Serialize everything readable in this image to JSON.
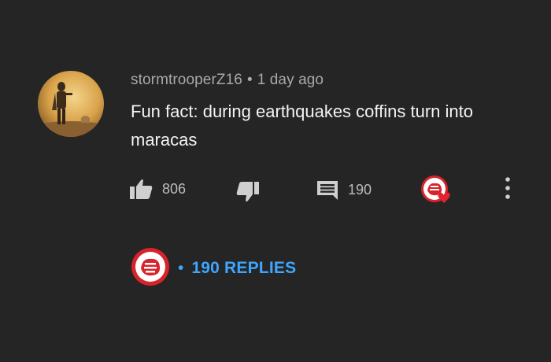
{
  "comment": {
    "username": "stormtrooperZ16",
    "separator": "•",
    "timestamp": "1 day ago",
    "text": "Fun fact: during earthquakes coffins turn into maracas",
    "avatar_icon": "mandalorian-avatar"
  },
  "actions": {
    "likes": "806",
    "reply_count": "190",
    "like_icon": "thumbs-up-icon",
    "dislike_icon": "thumbs-down-icon",
    "reply_icon": "comment-icon",
    "creator_heart_icon": "creator-heart-icon",
    "more_icon": "more-vertical-icon"
  },
  "replies": {
    "separator": "•",
    "label": "190 REPLIES"
  },
  "colors": {
    "background": "#252525",
    "link_blue": "#3ea6ff",
    "heart_red": "#e0242f"
  }
}
